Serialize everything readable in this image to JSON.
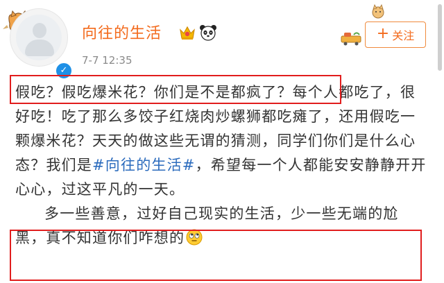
{
  "user": {
    "name": "向往的生活",
    "timestamp": "7-7 12:35",
    "verified_mark": "✓"
  },
  "follow_button": {
    "plus": "+",
    "label": "关注"
  },
  "post": {
    "seg1": "假吃？假吃爆米花？你们是不是都疯了？",
    "seg2": "每个人都吃了，很好吃！吃了那么多饺子红烧肉炒螺狮都吃瘫了，还用假吃一颗爆米花？天天的做这些无谓的猜测，同学们你们是什么心态？我们是",
    "hashtag": "#向往的生活#",
    "seg3": "，希望每一个人都能安安静静开开心心，过这平凡的一天。",
    "para2": "多一些善意，过好自己现实的生活，少一些无端的尬黑，真不知道你们咋想的"
  },
  "icons": {
    "crown": "crown-icon",
    "panda": "panda-icon",
    "eye_roll_emoji": "eye-roll-emoji-icon",
    "avatar": "default-avatar"
  },
  "colors": {
    "username": "#f36a1c",
    "hashtag": "#2b6bbd",
    "highlight_box": "#e11d1d",
    "verified": "#1e90e6"
  }
}
